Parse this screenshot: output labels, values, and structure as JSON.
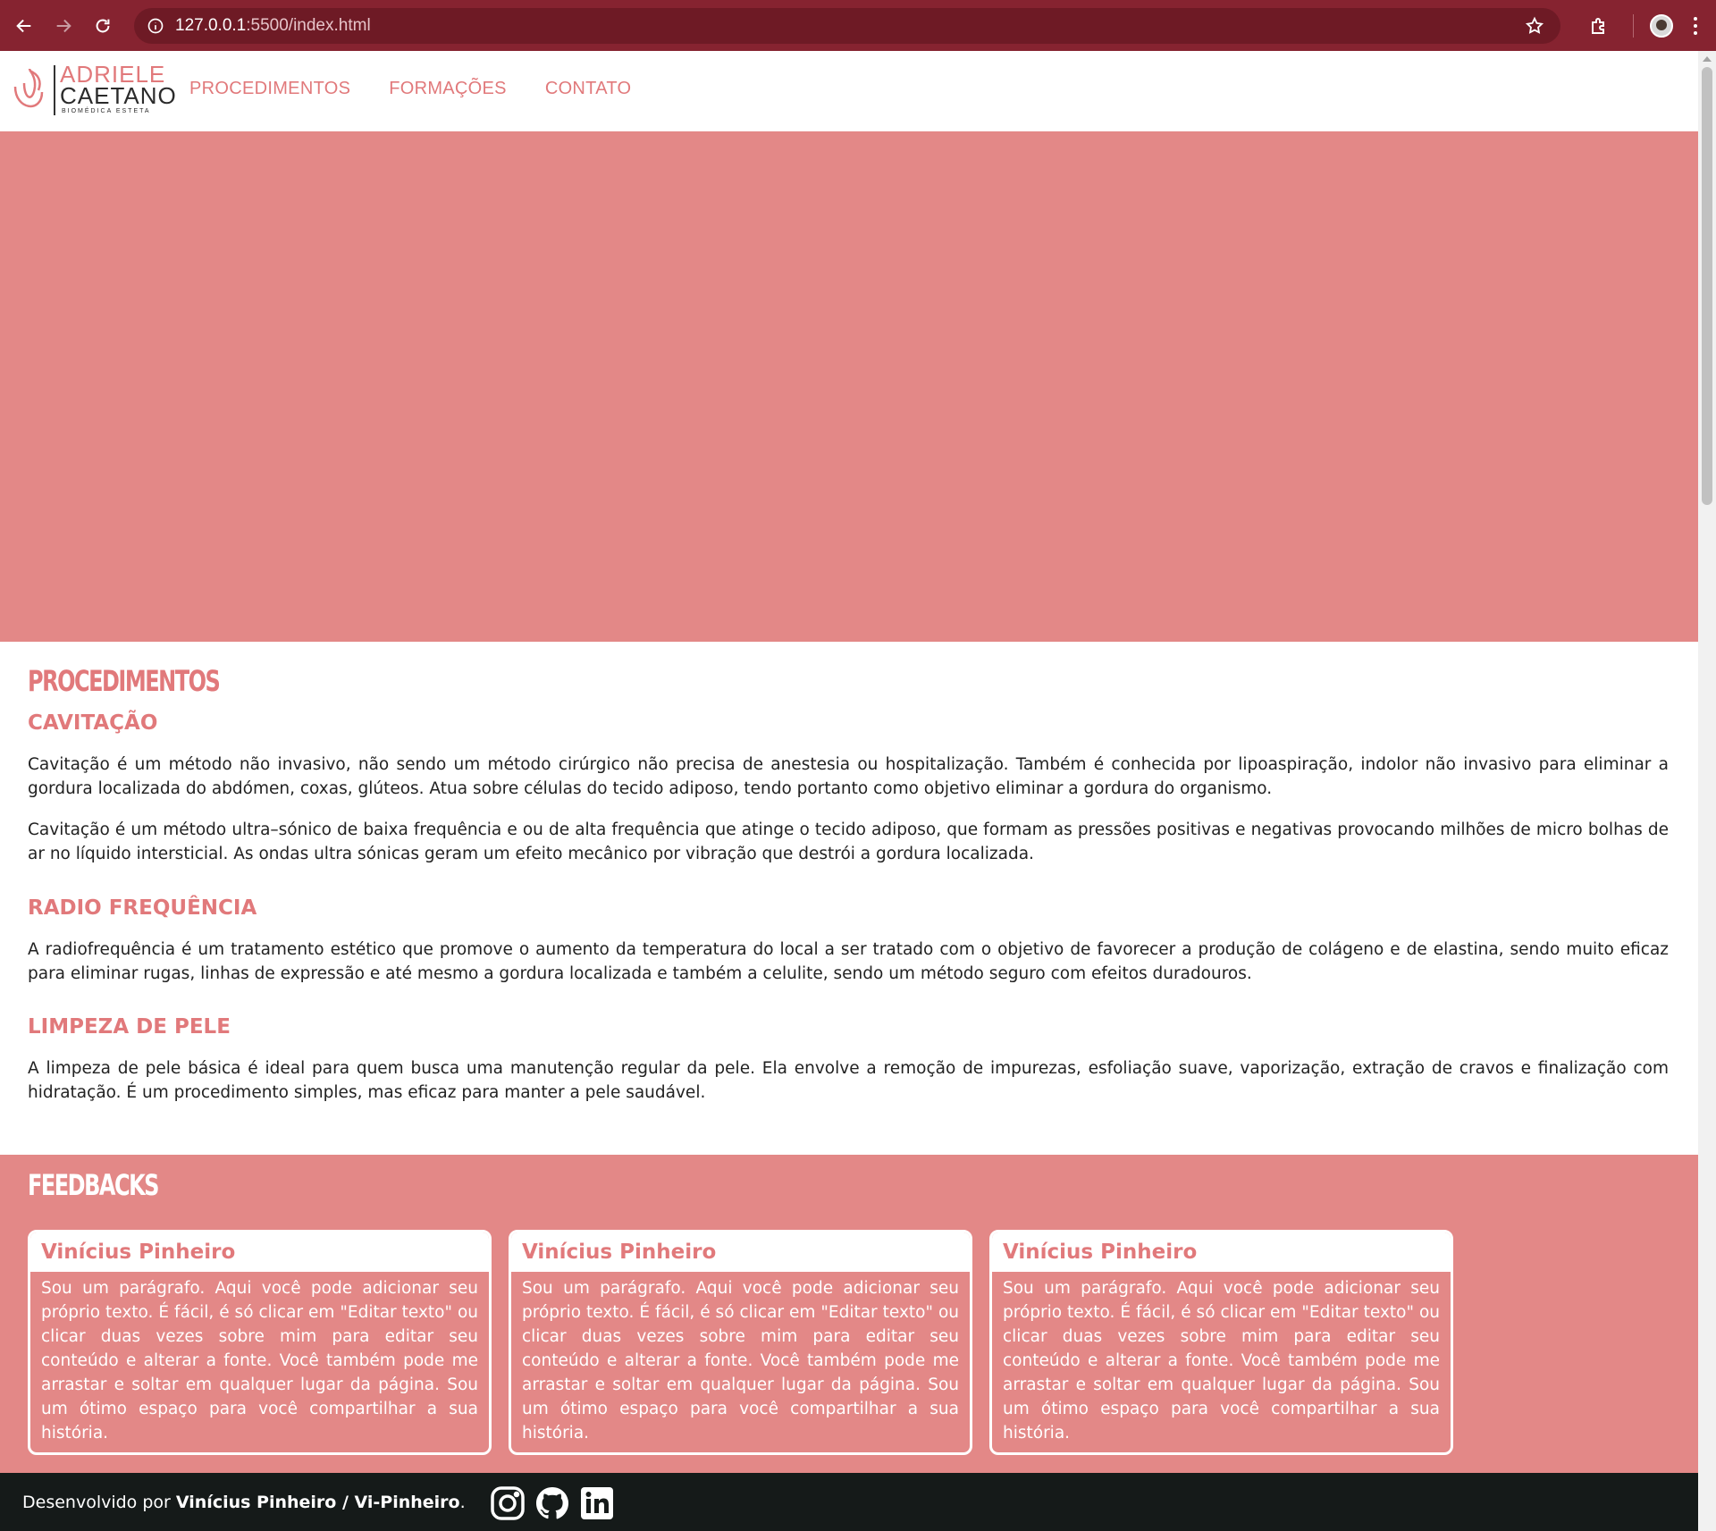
{
  "browser": {
    "url_host": "127.0.0.1",
    "url_path": ":5500/index.html"
  },
  "site": {
    "logo_line1": "ADRIELE",
    "logo_line2": "CAETANO",
    "logo_line3": "BIOMÉDICA ESTETA",
    "nav": [
      "PROCEDIMENTOS",
      "FORMAÇÕES",
      "CONTATO"
    ]
  },
  "procedures": {
    "title": "PROCEDIMENTOS",
    "items": [
      {
        "title": "CAVITAÇÃO",
        "paragraphs": [
          "Cavitação é um método não invasivo, não sendo um método cirúrgico não precisa de anestesia ou hospitalização. Também é conhecida por lipoaspiração, indolor não invasivo para eliminar a gordura localizada do abdómen, coxas, glúteos. Atua sobre células do tecido adiposo, tendo portanto como objetivo eliminar a gordura do organismo.",
          "Cavitação é um método ultra–sónico de baixa frequência e ou de alta frequência que atinge o tecido adiposo, que formam as pressões positivas e negativas provocando milhões de micro bolhas de ar no líquido intersticial. As ondas ultra sónicas geram um efeito mecânico por vibração que destrói a gordura localizada."
        ]
      },
      {
        "title": "RADIO FREQUÊNCIA",
        "paragraphs": [
          "A radiofrequência é um tratamento estético que promove o aumento da temperatura do local a ser tratado com o objetivo de favorecer a produção de colágeno e de elastina, sendo muito eficaz para eliminar rugas, linhas de expressão e até mesmo a gordura localizada e também a celulite, sendo um método seguro com efeitos duradouros."
        ]
      },
      {
        "title": "LIMPEZA DE PELE",
        "paragraphs": [
          "A limpeza de pele básica é ideal para quem busca uma manutenção regular da pele. Ela envolve a remoção de impurezas, esfoliação suave, vaporização, extração de cravos e finalização com hidratação. É um procedimento simples, mas eficaz para manter a pele saudável."
        ]
      }
    ]
  },
  "feedbacks": {
    "title": "FEEDBACKS",
    "cards": [
      {
        "name": "Vinícius Pinheiro",
        "text": "Sou um parágrafo. Aqui você pode adicionar seu próprio texto. É fácil, é só clicar em \"Editar texto\" ou clicar duas vezes sobre mim para editar seu conteúdo e alterar a fonte. Você também pode me arrastar e soltar em qualquer lugar da página. Sou um ótimo espaço para você compartilhar a sua história."
      },
      {
        "name": "Vinícius Pinheiro",
        "text": "Sou um parágrafo. Aqui você pode adicionar seu próprio texto. É fácil, é só clicar em \"Editar texto\" ou clicar duas vezes sobre mim para editar seu conteúdo e alterar a fonte. Você também pode me arrastar e soltar em qualquer lugar da página. Sou um ótimo espaço para você compartilhar a sua história."
      },
      {
        "name": "Vinícius Pinheiro",
        "text": "Sou um parágrafo. Aqui você pode adicionar seu próprio texto. É fácil, é só clicar em \"Editar texto\" ou clicar duas vezes sobre mim para editar seu conteúdo e alterar a fonte. Você também pode me arrastar e soltar em qualquer lugar da página. Sou um ótimo espaço para você compartilhar a sua história."
      }
    ]
  },
  "footer": {
    "prefix": "Desenvolvido por ",
    "author": "Vinícius Pinheiro / Vi-Pinheiro",
    "suffix": ".",
    "social_icons": [
      "instagram-icon",
      "github-icon",
      "linkedin-icon"
    ]
  },
  "colors": {
    "browser_bar": "#862330",
    "accent": "#e1797b",
    "hero_bg": "#e38887",
    "footer_bg": "#151a19"
  }
}
